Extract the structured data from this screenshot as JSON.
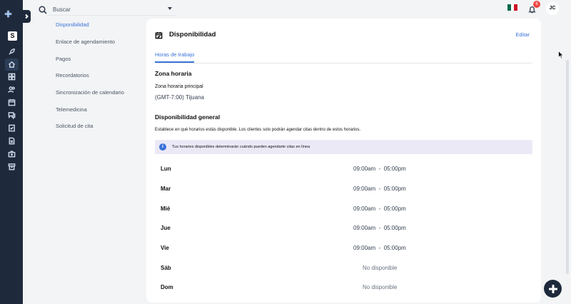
{
  "topbar": {
    "search_placeholder": "Buscar",
    "notifications_count": "6",
    "avatar_initials": "JC"
  },
  "rail": {
    "workspace_letter": "S",
    "icons": [
      "rocket-icon",
      "home-icon",
      "dashboard-icon",
      "users-icon",
      "calendar-icon",
      "chat-icon",
      "checklist-icon",
      "document-icon",
      "kit-icon",
      "archive-icon"
    ]
  },
  "settings_nav": {
    "items": [
      {
        "label": "Disponibilidad",
        "active": true
      },
      {
        "label": "Enlace de agendamiento",
        "active": false
      },
      {
        "label": "Pagos",
        "active": false
      },
      {
        "label": "Recordatorios",
        "active": false
      },
      {
        "label": "Sincronización de calendario",
        "active": false
      },
      {
        "label": "Telemedicina",
        "active": false
      },
      {
        "label": "Solicitud de cita",
        "active": false
      }
    ]
  },
  "card": {
    "title": "Disponibilidad",
    "edit_label": "Editar",
    "tab_label": "Horas de trabajo",
    "timezone_heading": "Zona horaria",
    "timezone_label": "Zona horaria principal",
    "timezone_value": "(GMT-7:00) Tijuana",
    "availability_heading": "Disponibilidad general",
    "availability_desc": "Establece en qué horarios estás disponible. Los clientes solo podrán agendar citas dentro de estos horarios.",
    "alert_text": "Tus horarios disponibles determinarán cuándo pueden agendarte citas en línea",
    "schedule": [
      {
        "day": "Lun",
        "hours": "09:00am  -  05:00pm"
      },
      {
        "day": "Mar",
        "hours": "09:00am  -  05:00pm"
      },
      {
        "day": "Mié",
        "hours": "09:00am  -  05:00pm"
      },
      {
        "day": "Jue",
        "hours": "09:00am  -  05:00pm"
      },
      {
        "day": "Vie",
        "hours": "09:00am  -  05:00pm"
      },
      {
        "day": "Sáb",
        "hours": "No disponible"
      },
      {
        "day": "Dom",
        "hours": "No disponible"
      }
    ]
  },
  "colors": {
    "accent": "#3b73d9",
    "rail": "#1e2a3b",
    "alert_bg": "#ece9f7",
    "badge": "#ef4444"
  }
}
